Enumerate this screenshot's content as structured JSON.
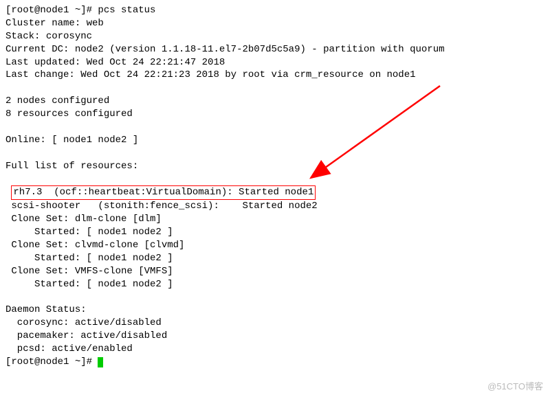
{
  "prompt1": "[root@node1 ~]# ",
  "cmd": "pcs status",
  "cluster_name_label": "Cluster name: ",
  "cluster_name": "web",
  "stack_label": "Stack: ",
  "stack": "corosync",
  "current_dc_label": "Current DC: ",
  "current_dc": "node2 (version 1.1.18-11.el7-2b07d5c5a9) - partition with quorum",
  "last_updated_label": "Last updated: ",
  "last_updated": "Wed Oct 24 22:21:47 2018",
  "last_change_label": "Last change: ",
  "last_change": "Wed Oct 24 22:21:23 2018 by root via crm_resource on node1",
  "nodes_configured": "2 nodes configured",
  "resources_configured": "8 resources configured",
  "online_label": "Online: ",
  "online": "[ node1 node2 ]",
  "full_list": "Full list of resources:",
  "highlighted_resource": "rh7.3  (ocf::heartbeat:VirtualDomain): Started node1",
  "resources": [
    " scsi-shooter   (stonith:fence_scsi):    Started node2",
    " Clone Set: dlm-clone [dlm]",
    "     Started: [ node1 node2 ]",
    " Clone Set: clvmd-clone [clvmd]",
    "     Started: [ node1 node2 ]",
    " Clone Set: VMFS-clone [VMFS]",
    "     Started: [ node1 node2 ]"
  ],
  "daemon_status_label": "Daemon Status:",
  "daemons": [
    "  corosync: active/disabled",
    "  pacemaker: active/disabled",
    "  pcsd: active/enabled"
  ],
  "prompt2": "[root@node1 ~]# ",
  "watermark": "@51CTO博客"
}
